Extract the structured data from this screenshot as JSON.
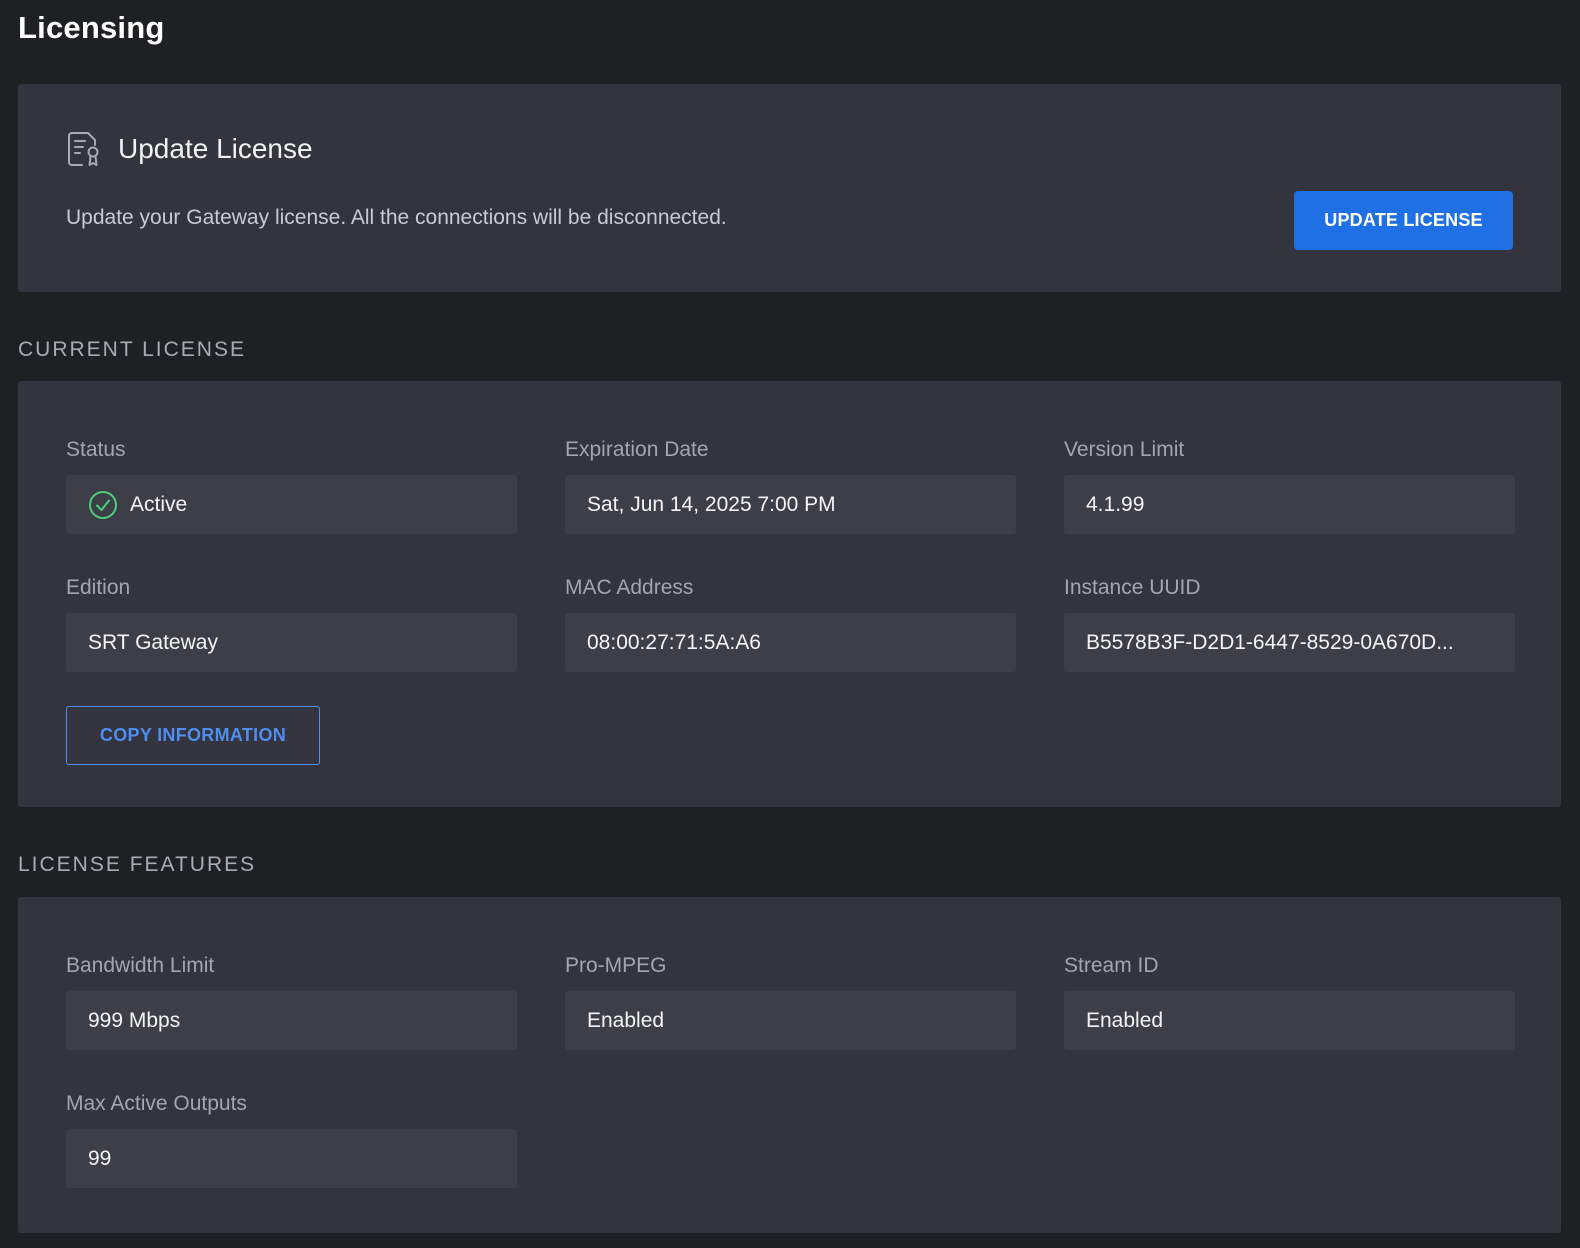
{
  "page": {
    "title": "Licensing"
  },
  "update_license": {
    "title": "Update License",
    "icon": "license-document-icon",
    "description": "Update your Gateway license. All the connections will be disconnected.",
    "button_label": "UPDATE LICENSE"
  },
  "current_license": {
    "section_title": "CURRENT LICENSE",
    "status": {
      "label": "Status",
      "value": "Active",
      "icon": "check-circle-icon",
      "color": "#4ccf7a"
    },
    "expiration": {
      "label": "Expiration Date",
      "value": "Sat, Jun 14, 2025 7:00 PM"
    },
    "version_limit": {
      "label": "Version Limit",
      "value": "4.1.99"
    },
    "edition": {
      "label": "Edition",
      "value": "SRT Gateway"
    },
    "mac_address": {
      "label": "MAC Address",
      "value": "08:00:27:71:5A:A6"
    },
    "instance_uuid": {
      "label": "Instance UUID",
      "value": "B5578B3F-D2D1-6447-8529-0A670D..."
    },
    "copy_button_label": "COPY INFORMATION"
  },
  "license_features": {
    "section_title": "LICENSE FEATURES",
    "bandwidth_limit": {
      "label": "Bandwidth Limit",
      "value": "999 Mbps"
    },
    "pro_mpeg": {
      "label": "Pro-MPEG",
      "value": "Enabled"
    },
    "stream_id": {
      "label": "Stream ID",
      "value": "Enabled"
    },
    "max_active_outputs": {
      "label": "Max Active Outputs",
      "value": "99"
    }
  },
  "colors": {
    "background": "#1f2023",
    "card": "#33343d",
    "field": "#3d3e48",
    "primary": "#1f6fe5",
    "outline_accent": "#4d8ef0"
  }
}
